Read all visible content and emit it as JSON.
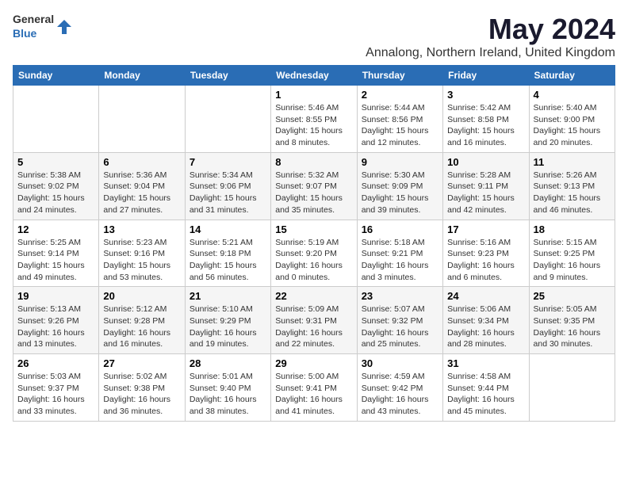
{
  "logo": {
    "general": "General",
    "blue": "Blue"
  },
  "title": "May 2024",
  "subtitle": "Annalong, Northern Ireland, United Kingdom",
  "days_of_week": [
    "Sunday",
    "Monday",
    "Tuesday",
    "Wednesday",
    "Thursday",
    "Friday",
    "Saturday"
  ],
  "weeks": [
    {
      "alt": false,
      "days": [
        {
          "number": "",
          "info": ""
        },
        {
          "number": "",
          "info": ""
        },
        {
          "number": "",
          "info": ""
        },
        {
          "number": "1",
          "sunrise": "5:46 AM",
          "sunset": "8:55 PM",
          "daylight": "15 hours and 8 minutes."
        },
        {
          "number": "2",
          "sunrise": "5:44 AM",
          "sunset": "8:56 PM",
          "daylight": "15 hours and 12 minutes."
        },
        {
          "number": "3",
          "sunrise": "5:42 AM",
          "sunset": "8:58 PM",
          "daylight": "15 hours and 16 minutes."
        },
        {
          "number": "4",
          "sunrise": "5:40 AM",
          "sunset": "9:00 PM",
          "daylight": "15 hours and 20 minutes."
        }
      ]
    },
    {
      "alt": true,
      "days": [
        {
          "number": "5",
          "sunrise": "5:38 AM",
          "sunset": "9:02 PM",
          "daylight": "15 hours and 24 minutes."
        },
        {
          "number": "6",
          "sunrise": "5:36 AM",
          "sunset": "9:04 PM",
          "daylight": "15 hours and 27 minutes."
        },
        {
          "number": "7",
          "sunrise": "5:34 AM",
          "sunset": "9:06 PM",
          "daylight": "15 hours and 31 minutes."
        },
        {
          "number": "8",
          "sunrise": "5:32 AM",
          "sunset": "9:07 PM",
          "daylight": "15 hours and 35 minutes."
        },
        {
          "number": "9",
          "sunrise": "5:30 AM",
          "sunset": "9:09 PM",
          "daylight": "15 hours and 39 minutes."
        },
        {
          "number": "10",
          "sunrise": "5:28 AM",
          "sunset": "9:11 PM",
          "daylight": "15 hours and 42 minutes."
        },
        {
          "number": "11",
          "sunrise": "5:26 AM",
          "sunset": "9:13 PM",
          "daylight": "15 hours and 46 minutes."
        }
      ]
    },
    {
      "alt": false,
      "days": [
        {
          "number": "12",
          "sunrise": "5:25 AM",
          "sunset": "9:14 PM",
          "daylight": "15 hours and 49 minutes."
        },
        {
          "number": "13",
          "sunrise": "5:23 AM",
          "sunset": "9:16 PM",
          "daylight": "15 hours and 53 minutes."
        },
        {
          "number": "14",
          "sunrise": "5:21 AM",
          "sunset": "9:18 PM",
          "daylight": "15 hours and 56 minutes."
        },
        {
          "number": "15",
          "sunrise": "5:19 AM",
          "sunset": "9:20 PM",
          "daylight": "16 hours and 0 minutes."
        },
        {
          "number": "16",
          "sunrise": "5:18 AM",
          "sunset": "9:21 PM",
          "daylight": "16 hours and 3 minutes."
        },
        {
          "number": "17",
          "sunrise": "5:16 AM",
          "sunset": "9:23 PM",
          "daylight": "16 hours and 6 minutes."
        },
        {
          "number": "18",
          "sunrise": "5:15 AM",
          "sunset": "9:25 PM",
          "daylight": "16 hours and 9 minutes."
        }
      ]
    },
    {
      "alt": true,
      "days": [
        {
          "number": "19",
          "sunrise": "5:13 AM",
          "sunset": "9:26 PM",
          "daylight": "16 hours and 13 minutes."
        },
        {
          "number": "20",
          "sunrise": "5:12 AM",
          "sunset": "9:28 PM",
          "daylight": "16 hours and 16 minutes."
        },
        {
          "number": "21",
          "sunrise": "5:10 AM",
          "sunset": "9:29 PM",
          "daylight": "16 hours and 19 minutes."
        },
        {
          "number": "22",
          "sunrise": "5:09 AM",
          "sunset": "9:31 PM",
          "daylight": "16 hours and 22 minutes."
        },
        {
          "number": "23",
          "sunrise": "5:07 AM",
          "sunset": "9:32 PM",
          "daylight": "16 hours and 25 minutes."
        },
        {
          "number": "24",
          "sunrise": "5:06 AM",
          "sunset": "9:34 PM",
          "daylight": "16 hours and 28 minutes."
        },
        {
          "number": "25",
          "sunrise": "5:05 AM",
          "sunset": "9:35 PM",
          "daylight": "16 hours and 30 minutes."
        }
      ]
    },
    {
      "alt": false,
      "days": [
        {
          "number": "26",
          "sunrise": "5:03 AM",
          "sunset": "9:37 PM",
          "daylight": "16 hours and 33 minutes."
        },
        {
          "number": "27",
          "sunrise": "5:02 AM",
          "sunset": "9:38 PM",
          "daylight": "16 hours and 36 minutes."
        },
        {
          "number": "28",
          "sunrise": "5:01 AM",
          "sunset": "9:40 PM",
          "daylight": "16 hours and 38 minutes."
        },
        {
          "number": "29",
          "sunrise": "5:00 AM",
          "sunset": "9:41 PM",
          "daylight": "16 hours and 41 minutes."
        },
        {
          "number": "30",
          "sunrise": "4:59 AM",
          "sunset": "9:42 PM",
          "daylight": "16 hours and 43 minutes."
        },
        {
          "number": "31",
          "sunrise": "4:58 AM",
          "sunset": "9:44 PM",
          "daylight": "16 hours and 45 minutes."
        },
        {
          "number": "",
          "info": ""
        }
      ]
    }
  ]
}
